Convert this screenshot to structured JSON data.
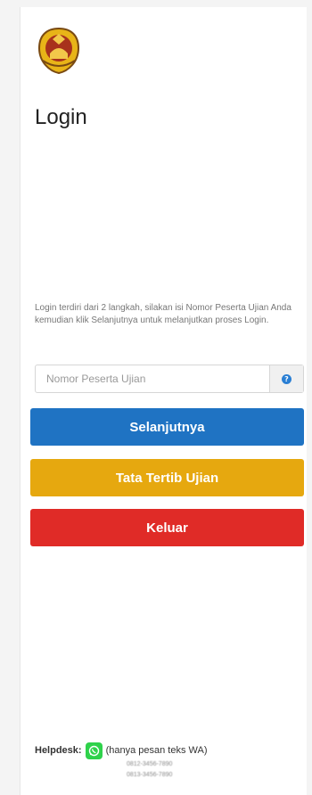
{
  "page_title": "Login",
  "info_text": "Login terdiri dari 2 langkah, silakan isi Nomor Peserta Ujian Anda kemudian klik Selanjutnya untuk melanjutkan proses Login.",
  "input": {
    "placeholder": "Nomor Peserta Ujian",
    "value": ""
  },
  "buttons": {
    "next": "Selanjutnya",
    "rules": "Tata Tertib Ujian",
    "exit": "Keluar"
  },
  "helpdesk": {
    "label": "Helpdesk:",
    "note": "(hanya pesan teks WA)",
    "phones": [
      "0812-3456-7890",
      "0813-3456-7890"
    ]
  },
  "colors": {
    "primary": "#1f73c3",
    "warning": "#e6a80f",
    "danger": "#e02b27",
    "whatsapp": "#2fd24b"
  },
  "icons": {
    "logo": "university-emblem-icon",
    "help": "question-circle-icon",
    "whatsapp": "whatsapp-icon"
  }
}
